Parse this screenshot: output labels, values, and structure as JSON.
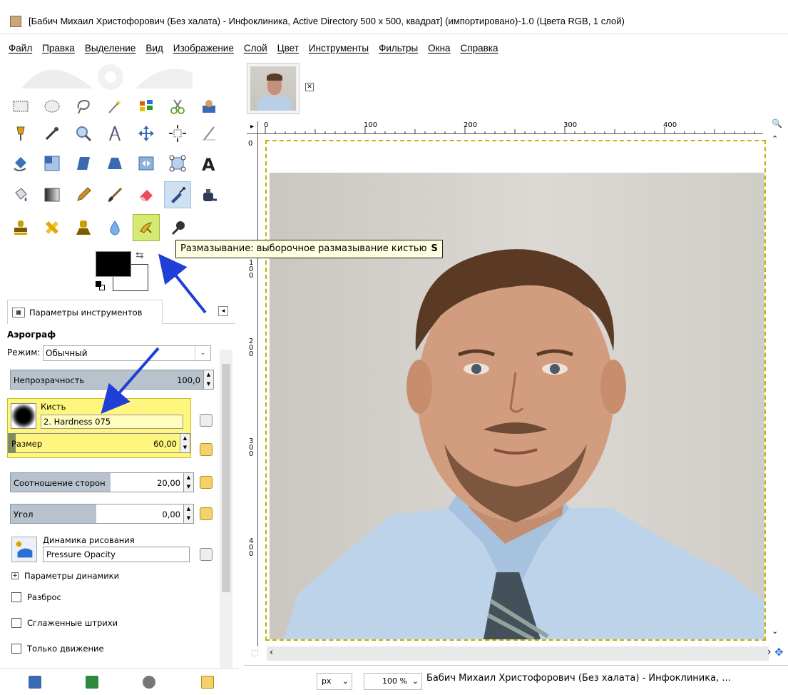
{
  "window": {
    "title": "[Бабич Михаил Христофорович (Без халата) - Инфоклиника, Active Directory 500 x 500, квадрат] (импортировано)-1.0 (Цвета RGB, 1 слой)"
  },
  "menu": [
    "Файл",
    "Правка",
    "Выделение",
    "Вид",
    "Изображение",
    "Слой",
    "Цвет",
    "Инструменты",
    "Фильтры",
    "Окна",
    "Справка"
  ],
  "tooltip": {
    "text": "Размазывание: выборочное размазывание кистью",
    "shortcut": "S"
  },
  "tool_options": {
    "tab_label": "Параметры инструментов",
    "tool_name": "Аэрограф",
    "mode_label": "Режим:",
    "mode_value": "Обычный",
    "opacity_label": "Непрозрачность",
    "opacity_value": "100,0",
    "brush_label": "Кисть",
    "brush_value": "2. Hardness 075",
    "size_label": "Размер",
    "size_value": "60,00",
    "aspect_label": "Соотношение сторон",
    "aspect_value": "20,00",
    "angle_label": "Угол",
    "angle_value": "0,00",
    "dynamics_label": "Динамика рисования",
    "dynamics_value": "Pressure Opacity",
    "dynamics_params_label": "Параметры динамики",
    "scatter_label": "Разброс",
    "smooth_label": "Сглаженные штрихи",
    "motion_only_label": "Только движение"
  },
  "ruler": {
    "h_ticks": [
      "0",
      "100",
      "200",
      "300",
      "400"
    ],
    "v_ticks": [
      "0",
      "1 0 0",
      "2 0 0",
      "3 0 0",
      "4 0 0"
    ]
  },
  "status": {
    "unit": "px",
    "zoom": "100 %",
    "image_title": "Бабич Михаил Христофорович (Без халата) - Инфоклиника, ..."
  },
  "colors": {
    "accent_yellow": "#fff680",
    "arrow_blue": "#1f3fd6",
    "highlight_green": "#d6ea73"
  }
}
